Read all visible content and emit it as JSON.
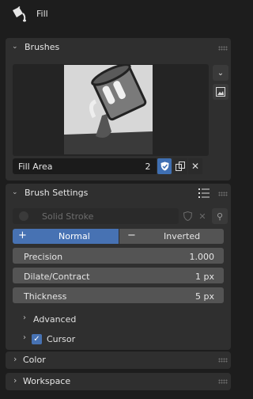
{
  "header": {
    "title": "Fill",
    "icon": "paint-bucket-icon"
  },
  "brushes": {
    "title": "Brushes",
    "brush_name": "Fill Area",
    "user_count": "2"
  },
  "brush_settings": {
    "title": "Brush Settings",
    "material_placeholder": "Solid Stroke",
    "mode": {
      "left": "Normal",
      "right": "Inverted",
      "left_symbol": "+",
      "right_symbol": "−",
      "selected": "Normal"
    },
    "fields": [
      {
        "label": "Precision",
        "value": "1.000"
      },
      {
        "label": "Dilate/Contract",
        "value": "1 px"
      },
      {
        "label": "Thickness",
        "value": "5 px"
      }
    ],
    "advanced_label": "Advanced",
    "cursor_label": "Cursor",
    "cursor_checked": true
  },
  "color_panel": {
    "title": "Color"
  },
  "workspace_panel": {
    "title": "Workspace"
  },
  "colors": {
    "accent": "#4772b3",
    "panel": "#2f2f2f",
    "background": "#1d1d1d"
  }
}
